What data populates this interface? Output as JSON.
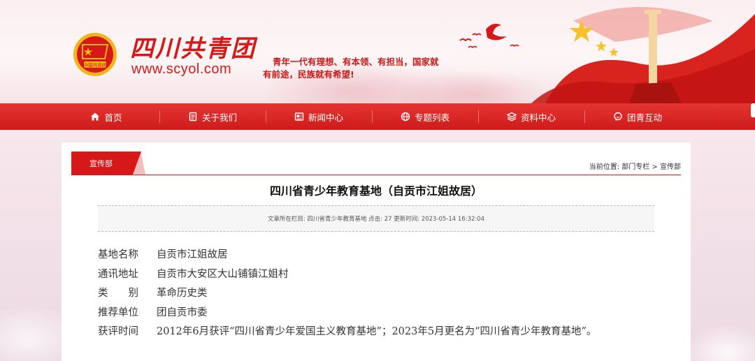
{
  "header": {
    "site_name": "四川共青团",
    "site_url": "www.scyol.com",
    "slogan_line1": "青年一代有理想、有本领、有担当，国家就",
    "slogan_line2": "有前途，民族就有希望!",
    "emblem_text": "中国共青团"
  },
  "nav": {
    "items": [
      {
        "label": "首页",
        "icon": "home-icon"
      },
      {
        "label": "关于我们",
        "icon": "document-icon"
      },
      {
        "label": "新闻中心",
        "icon": "news-icon"
      },
      {
        "label": "专题列表",
        "icon": "globe-icon"
      },
      {
        "label": "资料中心",
        "icon": "layers-icon"
      },
      {
        "label": "团青互动",
        "icon": "chat-icon"
      }
    ]
  },
  "section": {
    "tab_label": "宣传部",
    "breadcrumb": "当前位置: 部门专栏 > 宣传部"
  },
  "article": {
    "title": "四川省青少年教育基地（自贡市江姐故居）",
    "meta": "文章所在栏目: 四川省青少年教育基地 点击: 27 更新时间: 2023-05-14 16:32:04",
    "rows": [
      {
        "label": "基地名称",
        "value": "自贡市江姐故居"
      },
      {
        "label": "通讯地址",
        "value": "自贡市大安区大山铺镇江姐村"
      },
      {
        "label": "类　　别",
        "value": "革命历史类"
      },
      {
        "label": "推荐单位",
        "value": "团自贡市委"
      },
      {
        "label": "获评时间",
        "value": "2012年6月获评“四川省青少年爱国主义教育基地”；2023年5月更名为“四川省青少年教育基地”。"
      }
    ]
  },
  "colors": {
    "brand_red": "#d71818",
    "nav_red": "#d9231f"
  }
}
